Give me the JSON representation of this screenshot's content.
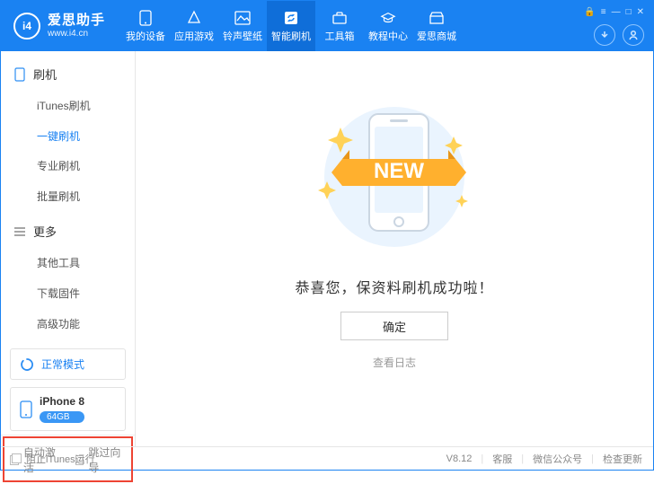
{
  "brand": {
    "logo_text": "i4",
    "name_cn": "爱思助手",
    "url": "www.i4.cn"
  },
  "nav": {
    "items": [
      {
        "label": "我的设备"
      },
      {
        "label": "应用游戏"
      },
      {
        "label": "铃声壁纸"
      },
      {
        "label": "智能刷机"
      },
      {
        "label": "工具箱"
      },
      {
        "label": "教程中心"
      },
      {
        "label": "爱思商城"
      }
    ],
    "active_index": 3
  },
  "sidebar": {
    "sections": [
      {
        "title": "刷机",
        "items": [
          {
            "label": "iTunes刷机"
          },
          {
            "label": "一键刷机"
          },
          {
            "label": "专业刷机"
          },
          {
            "label": "批量刷机"
          }
        ],
        "active_index": 1
      },
      {
        "title": "更多",
        "items": [
          {
            "label": "其他工具"
          },
          {
            "label": "下载固件"
          },
          {
            "label": "高级功能"
          }
        ],
        "active_index": -1
      }
    ],
    "status_label": "正常模式",
    "device": {
      "name": "iPhone 8",
      "storage": "64GB"
    },
    "checks": {
      "auto_activate": "自动激活",
      "skip_guide": "跳过向导"
    }
  },
  "main": {
    "new_banner": "NEW",
    "success_text": "恭喜您，保资料刷机成功啦！",
    "ok_label": "确定",
    "log_label": "查看日志"
  },
  "statusbar": {
    "prevent_itunes": "阻止iTunes运行",
    "version": "V8.12",
    "links": [
      "客服",
      "微信公众号",
      "检查更新"
    ]
  }
}
